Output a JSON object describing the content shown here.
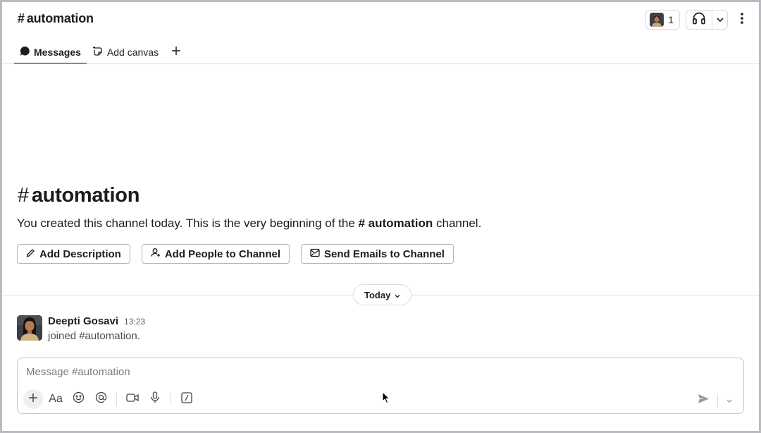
{
  "header": {
    "hash": "#",
    "channel_name": "automation",
    "member_count": "1"
  },
  "tabs": [
    {
      "label": "Messages",
      "icon": "message-bubble-icon"
    },
    {
      "label": "Add canvas",
      "icon": "canvas-icon"
    }
  ],
  "intro": {
    "hash": "#",
    "title": "automation",
    "text_before": "You created this channel today. This is the very beginning of the ",
    "channel_ref": "# automation",
    "text_after": " channel.",
    "buttons": [
      {
        "label": "Add Description",
        "icon": "pencil-icon"
      },
      {
        "label": "Add People to Channel",
        "icon": "add-person-icon"
      },
      {
        "label": "Send Emails to Channel",
        "icon": "email-icon"
      }
    ]
  },
  "day_divider": {
    "label": "Today"
  },
  "messages": [
    {
      "author": "Deepti Gosavi",
      "time": "13:23",
      "text": "joined #automation."
    }
  ],
  "composer": {
    "placeholder": "Message #automation",
    "format_label": "Aa"
  },
  "colors": {
    "text": "#1d1c1d",
    "border": "#dddddd",
    "muted": "#616061"
  }
}
